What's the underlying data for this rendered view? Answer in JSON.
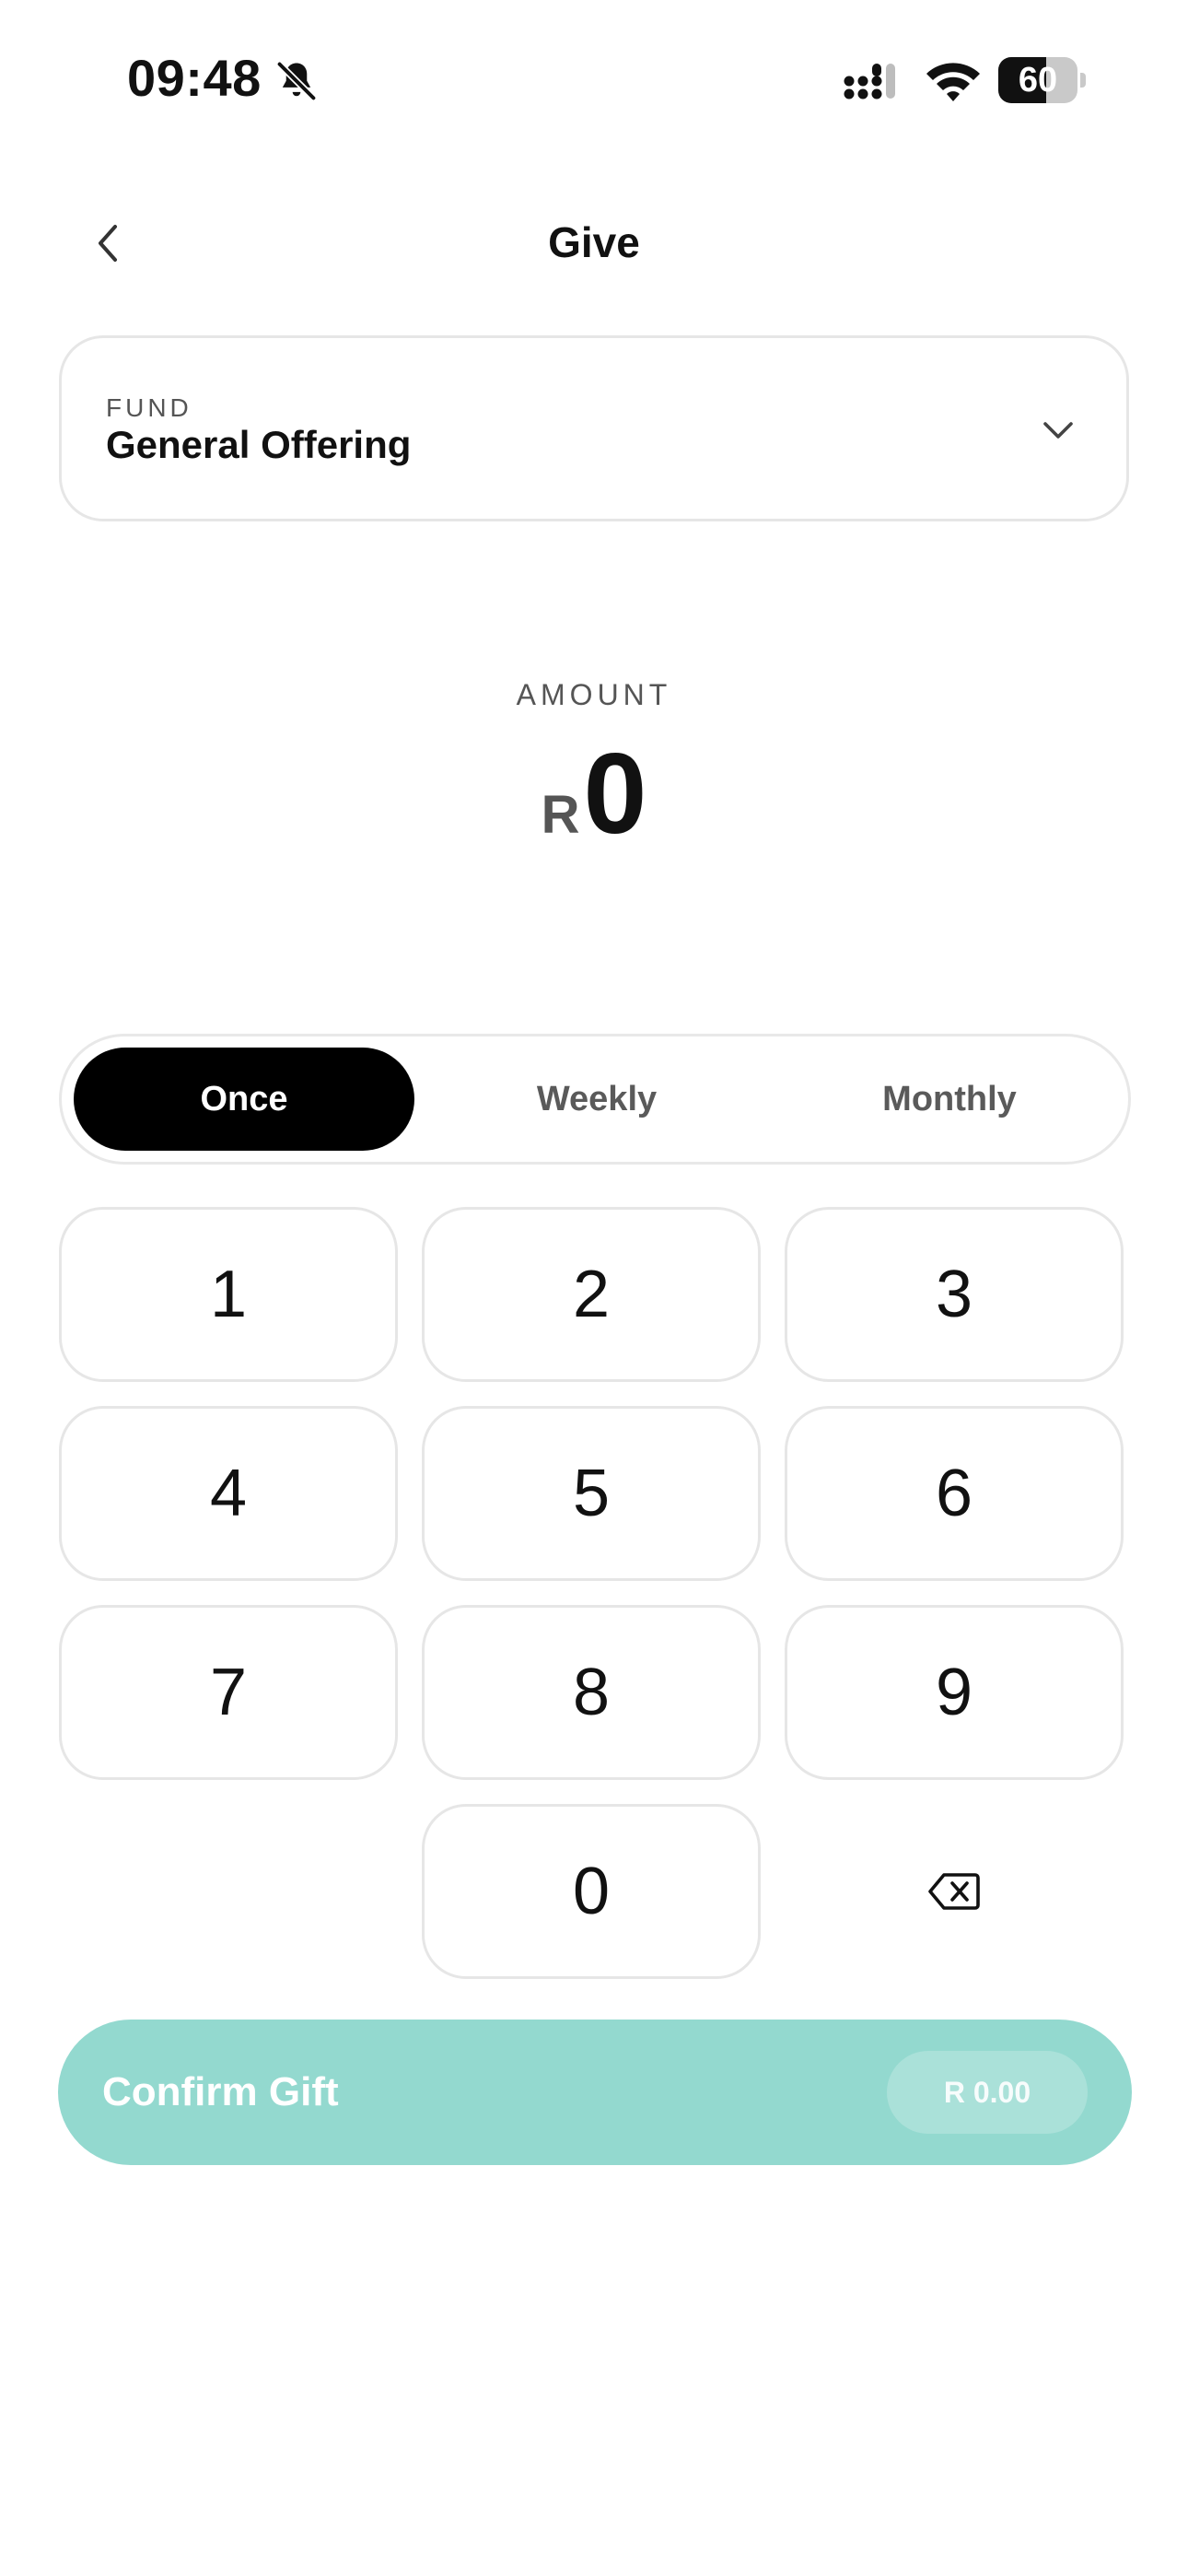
{
  "status_bar": {
    "time": "09:48",
    "battery": "60",
    "battery_level": 0.6,
    "icons": [
      "bell-slash-icon",
      "cellular-signal-icon",
      "wifi-icon",
      "battery-icon"
    ]
  },
  "header": {
    "title": "Give",
    "back_icon": "chevron-left-icon"
  },
  "fund": {
    "label": "FUND",
    "value": "General Offering",
    "icon": "chevron-down-icon"
  },
  "amount": {
    "label": "AMOUNT",
    "currency": "R",
    "value": "0"
  },
  "frequency": {
    "options": [
      "Once",
      "Weekly",
      "Monthly"
    ],
    "selected": "Once"
  },
  "keypad": {
    "keys": [
      "1",
      "2",
      "3",
      "4",
      "5",
      "6",
      "7",
      "8",
      "9",
      "0"
    ],
    "backspace_icon": "backspace-icon"
  },
  "confirm": {
    "label": "Confirm Gift",
    "amount": "R 0.00",
    "color": "#93d9cf"
  }
}
